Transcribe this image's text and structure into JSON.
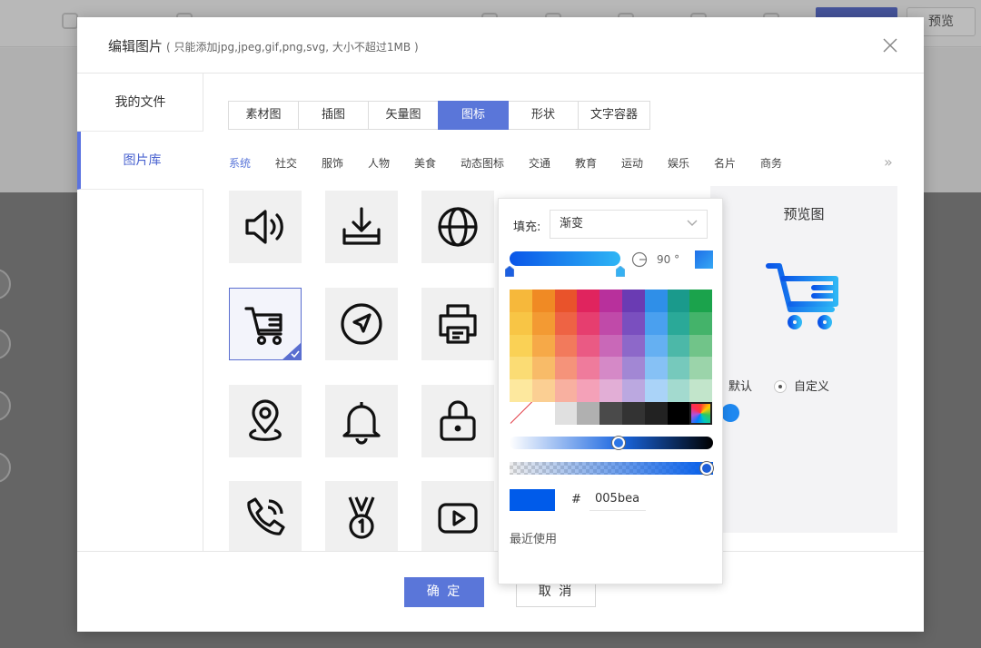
{
  "background": {
    "preview_button": "预览"
  },
  "dialog": {
    "title": "编辑图片",
    "subtitle": "( 只能添加jpg,jpeg,gif,png,svg, 大小不超过1MB )",
    "close_icon": "close-icon",
    "sidebar": [
      {
        "label": "我的文件",
        "active": false
      },
      {
        "label": "图片库",
        "active": true
      }
    ],
    "tabs": [
      {
        "label": "素材图",
        "active": false
      },
      {
        "label": "插图",
        "active": false
      },
      {
        "label": "矢量图",
        "active": false
      },
      {
        "label": "图标",
        "active": true
      },
      {
        "label": "形状",
        "active": false
      },
      {
        "label": "文字容器",
        "active": false
      }
    ],
    "categories": [
      {
        "label": "系统",
        "active": true
      },
      {
        "label": "社交"
      },
      {
        "label": "服饰"
      },
      {
        "label": "人物"
      },
      {
        "label": "美食"
      },
      {
        "label": "动态图标"
      },
      {
        "label": "交通"
      },
      {
        "label": "教育"
      },
      {
        "label": "运动"
      },
      {
        "label": "娱乐"
      },
      {
        "label": "名片"
      },
      {
        "label": "商务"
      }
    ],
    "more_categories": "»",
    "icons": [
      "speaker-icon",
      "download-icon",
      "globe-icon",
      "cart-icon",
      "navigation-icon",
      "printer-icon",
      "location-pin-icon",
      "bell-icon",
      "lock-icon",
      "phone-icon",
      "medal-icon",
      "video-play-icon"
    ],
    "selected_icon": "cart-icon",
    "preview": {
      "title": "预览图",
      "radio_default": "默认",
      "radio_custom": "自定义",
      "selected_radio": "自定义"
    },
    "ok_button": "确 定",
    "cancel_button": "取 消"
  },
  "color_picker": {
    "fill_label": "填充:",
    "fill_mode": "渐变",
    "gradient_angle": "90 °",
    "gradient_start": "#0a55e8",
    "gradient_end": "#2eb6f5",
    "palette": [
      "#f6b83b",
      "#f08a24",
      "#e9532b",
      "#e0245e",
      "#b8309c",
      "#6a3bb3",
      "#2f8fe8",
      "#1a9a8c",
      "#1ba34c",
      "#f8c545",
      "#f39a33",
      "#ee6344",
      "#e63e6f",
      "#c04aa9",
      "#7a4fbf",
      "#4aa0ef",
      "#2aa998",
      "#44b36a",
      "#fad155",
      "#f6a948",
      "#f27a5c",
      "#ea5a84",
      "#c968b8",
      "#8d68c9",
      "#65b0f2",
      "#4cb8a8",
      "#71c489",
      "#fbdc74",
      "#f8bb68",
      "#f5937a",
      "#ef7b9c",
      "#d589c7",
      "#a287d4",
      "#86c1f5",
      "#76c9bc",
      "#9bd4aa",
      "#fde89e",
      "#fbcf93",
      "#f8b0a0",
      "#f4a1b8",
      "#e2aed6",
      "#bba8e0",
      "#aad3f8",
      "#a3dacf",
      "#c2e5cb",
      "none",
      "#ffffff",
      "#e0e0e0",
      "#b0b0b0",
      "#4a4a4a",
      "#333333",
      "#222222",
      "#000000",
      "rainbow"
    ],
    "hex_prefix": "#",
    "hex_value": "005bea",
    "current_color": "#005bea",
    "recent_label": "最近使用"
  }
}
